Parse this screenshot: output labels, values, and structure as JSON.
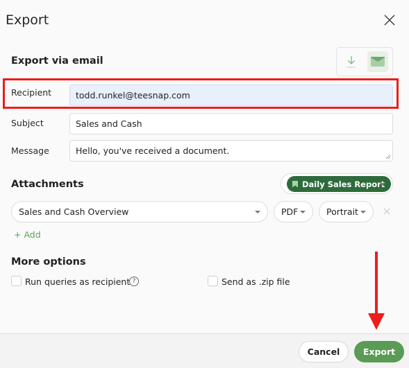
{
  "dialog": {
    "title": "Export",
    "close_icon": "close-icon"
  },
  "email_section": {
    "title": "Export via email",
    "modes": [
      {
        "name": "download",
        "icon": "download-icon",
        "active": false
      },
      {
        "name": "email",
        "icon": "envelope-icon",
        "active": true
      }
    ],
    "recipient": {
      "label": "Recipient",
      "value": "todd.runkel@teesnap.com"
    },
    "subject": {
      "label": "Subject",
      "value": "Sales and Cash"
    },
    "message": {
      "label": "Message",
      "value": "Hello, you've received a document."
    }
  },
  "attachments": {
    "title": "Attachments",
    "report_badge": "Daily Sales Report",
    "items": [
      {
        "name": "Sales and Cash Overview",
        "format": "PDF",
        "orientation": "Portrait"
      }
    ],
    "add_label": "Add"
  },
  "more_options": {
    "title": "More options",
    "run_queries": {
      "label": "Run queries as recipient",
      "checked": false
    },
    "send_zip": {
      "label": "Send as .zip file",
      "checked": false
    }
  },
  "footer": {
    "cancel_label": "Cancel",
    "export_label": "Export"
  },
  "colors": {
    "accent": "#5a9b55",
    "badge": "#2e6b3c",
    "annotation": "#ee1c1c"
  }
}
